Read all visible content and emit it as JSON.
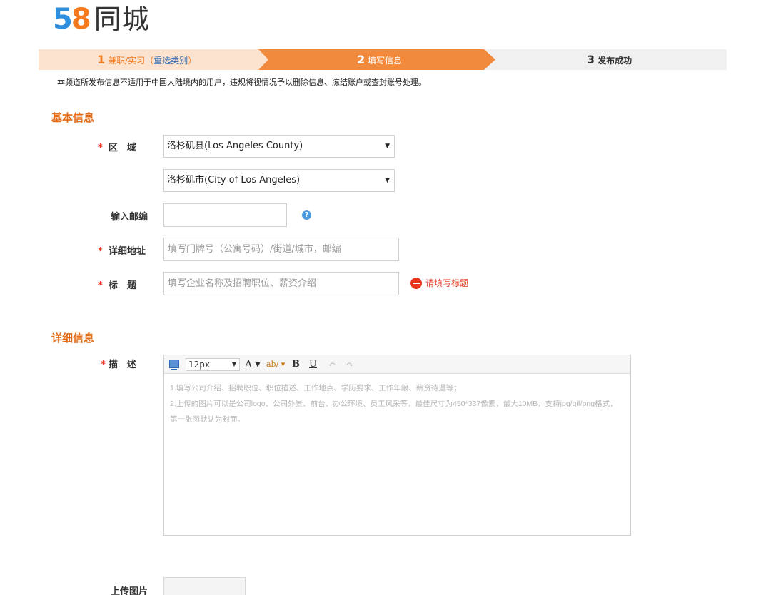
{
  "logo": {
    "digit1": "5",
    "digit2": "8",
    "brand": "同城"
  },
  "steps": [
    {
      "num": "1",
      "label": "兼职/实习（",
      "link": "重选类别",
      "suffix": "）"
    },
    {
      "num": "2",
      "label": "填写信息"
    },
    {
      "num": "3",
      "label": "发布成功"
    }
  ],
  "notice": "本频道所发布信息不适用于中国大陆境内的用户，违规将视情况予以删除信息、冻结账户或查封账号处理。",
  "basic": {
    "title": "基本信息",
    "region_label": "区　域",
    "region_value_1": "洛杉矶县(Los Angeles County)",
    "region_value_2": "洛杉矶市(City of Los Angeles)",
    "postcode_label": "输入邮编",
    "postcode_value": "",
    "address_label": "详细地址",
    "address_placeholder": "填写门牌号（公寓号码）/街道/城市，邮编",
    "title_label": "标　题",
    "title_placeholder": "填写企业名称及招聘职位、薪资介绍",
    "title_error": "请填写标题"
  },
  "detail": {
    "title": "详细信息",
    "desc_label": "描　述",
    "font_size": "12px",
    "placeholder_line1": "1.填写公司介绍、招聘职位、职位描述、工作地点、学历要求、工作年限、薪资待遇等；",
    "placeholder_line2": "2.上传的图片可以是公司logo、公司外景、前台、办公环境、员工风采等，最佳尺寸为450*337像素，最大10MB，支持jpg/gif/png格式，第一张图默认为封面。"
  },
  "upload": {
    "label": "上传图片"
  },
  "required_mark": "*",
  "colors": {
    "accent": "#f47a20",
    "accent_light": "#fbe3cf",
    "error": "#e8341c",
    "link": "#3a6fb0"
  }
}
